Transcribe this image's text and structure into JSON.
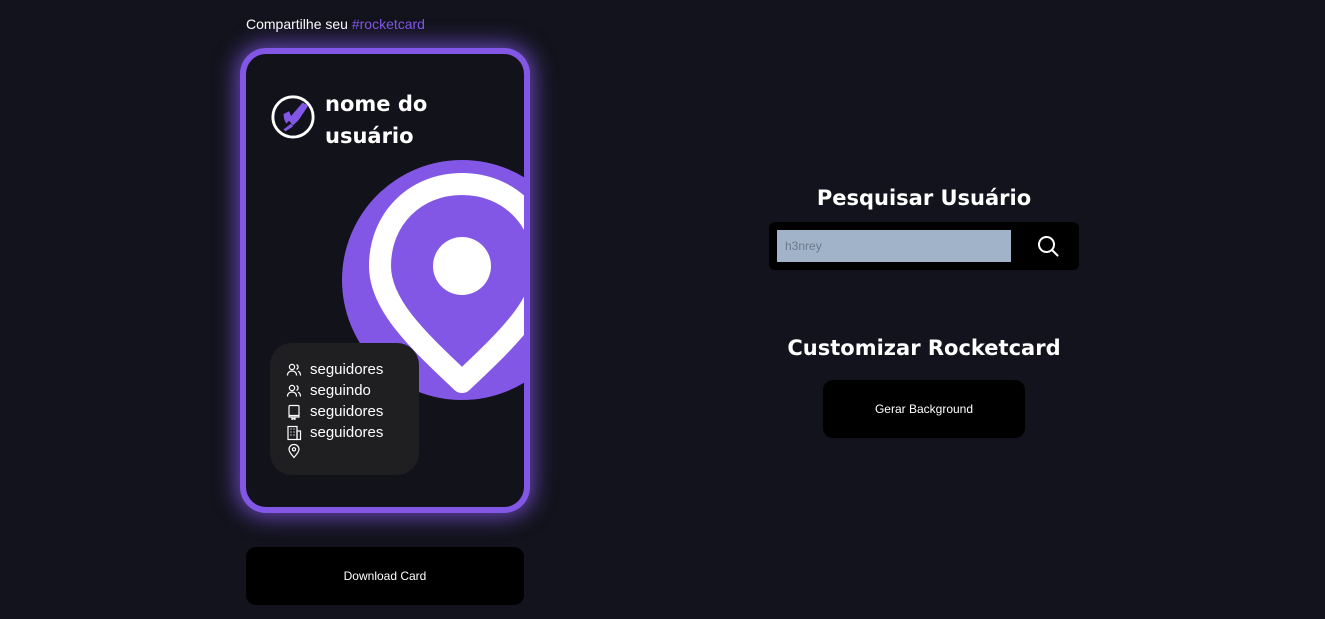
{
  "header": {
    "share_prefix": "Compartilhe seu",
    "share_tag": "#rocketcard"
  },
  "card": {
    "username": "nome do usuário",
    "stats": [
      {
        "icon": "users-icon",
        "label": "seguidores"
      },
      {
        "icon": "users-icon",
        "label": "seguindo"
      },
      {
        "icon": "repo-icon",
        "label": "seguidores"
      },
      {
        "icon": "building-icon",
        "label": "seguidores"
      },
      {
        "icon": "location-icon",
        "label": ""
      }
    ]
  },
  "actions": {
    "download_label": "Download Card"
  },
  "search": {
    "title": "Pesquisar Usuário",
    "placeholder": "h3nrey",
    "value": ""
  },
  "customize": {
    "title": "Customizar Rocketcard",
    "background_button_label": "Gerar Background"
  },
  "colors": {
    "accent": "#8257e5",
    "background": "#12131c",
    "card_background": "#12121a",
    "input_background": "#a0b3c9"
  }
}
